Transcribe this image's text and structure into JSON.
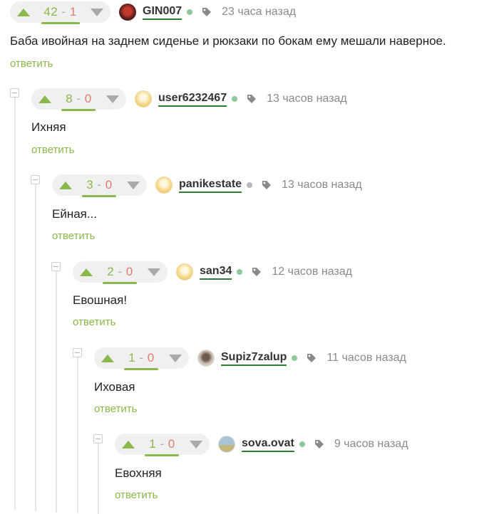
{
  "colors": {
    "accent_green": "#8ab84a",
    "minus_red": "#e07a6a",
    "username_underline": "#2e7d32",
    "online_dot": "#8fc99b",
    "offline_dot": "#b9b9b9",
    "muted_text": "#8a8a8a"
  },
  "icons": {
    "upvote": "triangle-up",
    "downvote": "triangle-down",
    "tag": "tag-icon",
    "collapse": "minus-square"
  },
  "comments": [
    {
      "score": {
        "plus": "42",
        "sep": " - ",
        "minus": "1"
      },
      "username": "GIN007",
      "online": true,
      "time": "23 часа назад",
      "text": "Баба ивойная на заднем сиденье и рюкзаки по бокам ему мешали наверное.",
      "reply": "ответить"
    },
    {
      "score": {
        "plus": "8",
        "sep": " - ",
        "minus": "0"
      },
      "username": "user6232467",
      "online": true,
      "time": "13 часов назад",
      "text": "Ихняя",
      "reply": "ответить"
    },
    {
      "score": {
        "plus": "3",
        "sep": " - ",
        "minus": "0"
      },
      "username": "panikestate",
      "online": false,
      "time": "13 часов назад",
      "text": "Ейная...",
      "reply": "ответить"
    },
    {
      "score": {
        "plus": "2",
        "sep": " - ",
        "minus": "0"
      },
      "username": "san34",
      "online": true,
      "time": "12 часов назад",
      "text": "Евошная!",
      "reply": "ответить"
    },
    {
      "score": {
        "plus": "1",
        "sep": " - ",
        "minus": "0"
      },
      "username": "Supiz7zalup",
      "online": true,
      "time": "11 часов назад",
      "text": "Иховая",
      "reply": "ответить"
    },
    {
      "score": {
        "plus": "1",
        "sep": " - ",
        "minus": "0"
      },
      "username": "sova.ovat",
      "online": true,
      "time": "9 часов назад",
      "text": "Евохняя",
      "reply": "ответить"
    }
  ]
}
